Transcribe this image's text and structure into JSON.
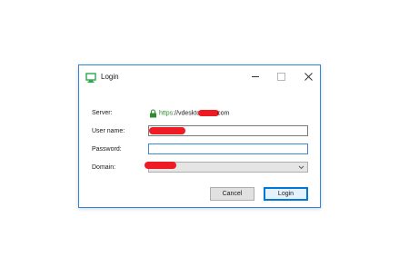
{
  "window": {
    "title": "Login"
  },
  "form": {
    "server_label": "Server:",
    "server_prefix": "https",
    "server_mid": "://vdeskto",
    "server_suffix": "com",
    "username_label": "User name:",
    "password_label": "Password:",
    "domain_label": "Domain:"
  },
  "buttons": {
    "cancel_label": "Cancel",
    "login_label": "Login"
  },
  "icons": {
    "app": "desktop-connection-icon",
    "lock": "lock-icon",
    "minimize": "minimize-icon",
    "maximize": "maximize-icon",
    "close": "close-icon",
    "dropdown": "chevron-down-icon"
  },
  "colors": {
    "accent": "#0078d7",
    "https_green": "#2e8b2e",
    "redaction": "#ee1b24"
  }
}
